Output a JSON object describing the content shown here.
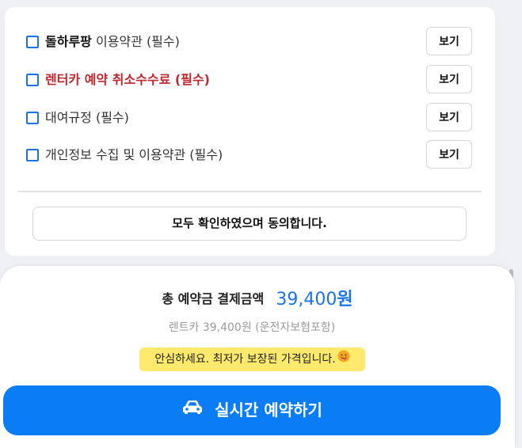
{
  "terms": {
    "items": [
      {
        "bold_part": "돌하루팡",
        "label": " 이용약관 (필수)",
        "view_label": "보기",
        "checked": false,
        "color": "#333333"
      },
      {
        "bold_part": "",
        "label": "렌터카 예약 취소수수료 (필수)",
        "view_label": "보기",
        "checked": false,
        "color": "#c0262d"
      },
      {
        "bold_part": "",
        "label": " 대여규정 (필수)",
        "view_label": "보기",
        "checked": false,
        "color": "#333333"
      },
      {
        "bold_part": "",
        "label": "개인정보 수집 및 이용약관 (필수)",
        "view_label": "보기",
        "checked": false,
        "color": "#333333"
      }
    ],
    "agree_all_label": "모두 확인하였으며 동의합니다."
  },
  "payment": {
    "total_label": "총 예약금 결제금액",
    "total_amount": "39,400",
    "total_unit": "원",
    "sub_note": "렌트카 39,400원 (운전자보험포함)",
    "badge_text": "안심하세요. 최저가 보장된 가격입니다.",
    "badge_icon": "smile-tongue-emoji",
    "reserve_label": "실시간 예약하기",
    "reserve_icon": "car-icon",
    "accent_color": "#0a7cf5",
    "badge_color": "#fde96b"
  }
}
